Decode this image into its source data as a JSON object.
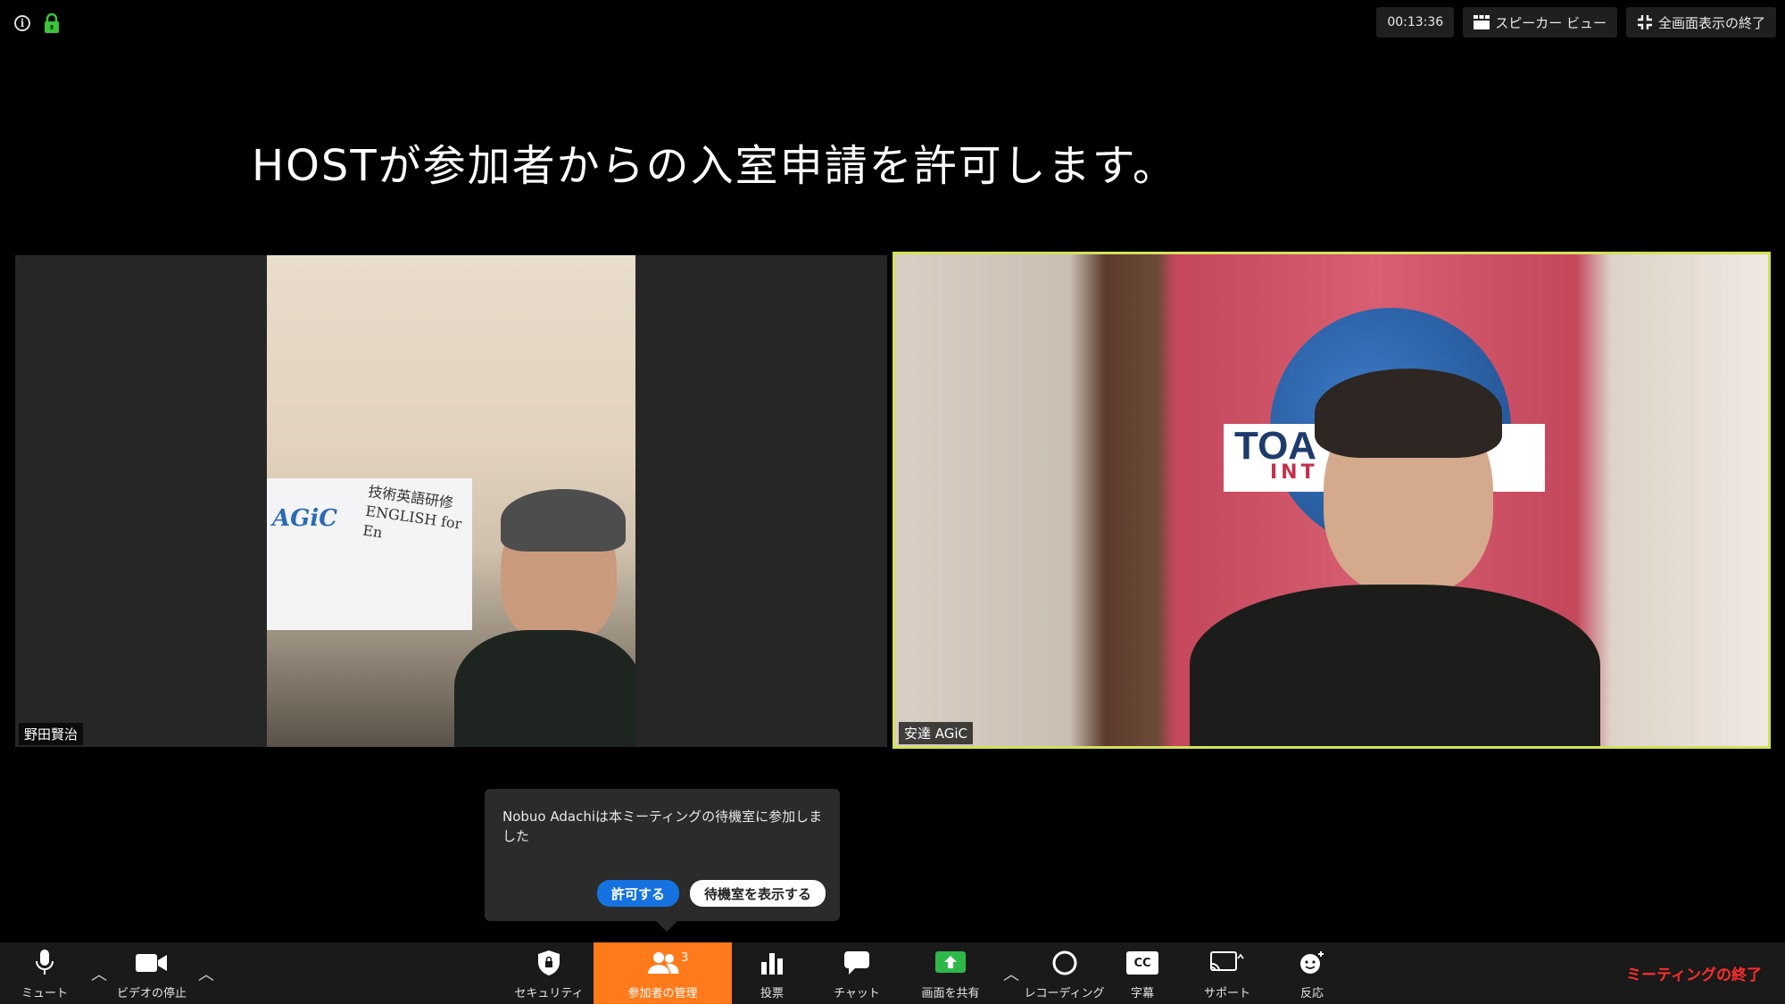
{
  "top": {
    "timer": "00:13:36",
    "speaker_view": "スピーカー ビュー",
    "exit_fullscreen": "全画面表示の終了"
  },
  "banner": "HOSTが参加者からの入室申請を許可します。",
  "tiles": {
    "left_name": "野田賢治",
    "right_name": "安達 AGiC",
    "left_poster_logo": "AGiC",
    "left_poster_text_1": "技術英語研修",
    "left_poster_text_2": "ENGLISH for En",
    "right_sign": "TOA",
    "right_sign_sub": "INT"
  },
  "notification": {
    "message": "Nobuo Adachiは本ミーティングの待機室に参加しました",
    "allow": "許可する",
    "show_waiting_room": "待機室を表示する"
  },
  "toolbar": {
    "mute": "ミュート",
    "video": "ビデオの停止",
    "security": "セキュリティ",
    "participants": "参加者の管理",
    "participants_count": "3",
    "polls": "投票",
    "chat": "チャット",
    "share": "画面を共有",
    "recording": "レコーディング",
    "captions": "字幕",
    "captions_icon_text": "CC",
    "support": "サポート",
    "reactions": "反応",
    "end": "ミーティングの終了"
  },
  "colors": {
    "active_speaker_border": "#d3e05a",
    "participants_active": "#ff7a1a",
    "allow_button": "#1672e0",
    "end_meeting": "#ff2d2d",
    "security_lock": "#3cc43c"
  }
}
